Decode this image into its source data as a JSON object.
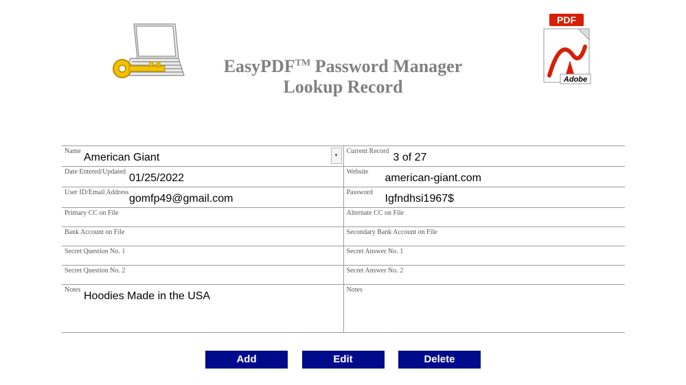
{
  "header": {
    "title_line1_pre": "EasyPDF",
    "title_line1_tm": "TM",
    "title_line1_post": " Password Manager",
    "title_line2": "Lookup Record",
    "pdf_badge": "PDF",
    "adobe_label": "Adobe"
  },
  "fields": {
    "name_label": "Name",
    "name_value": "American Giant",
    "current_record_label": "Current Record",
    "current_record_value": "3 of 27",
    "date_label": "Date Entered/Updated",
    "date_value": "01/25/2022",
    "website_label": "Website",
    "website_value": "american-giant.com",
    "userid_label": "User ID/Email Address",
    "userid_value": "gomfp49@gmail.com",
    "password_label": "Password",
    "password_value": "Igfndhsi1967$",
    "primary_cc_label": "Primary CC on File",
    "primary_cc_value": "",
    "alternate_cc_label": "Alternate CC on File",
    "alternate_cc_value": "",
    "bank_label": "Bank Account on File",
    "bank_value": "",
    "secondary_bank_label": "Secondary Bank Account on File",
    "secondary_bank_value": "",
    "secret_q1_label": "Secret Question No. 1",
    "secret_q1_value": "",
    "secret_a1_label": "Secret Answer No. 1",
    "secret_a1_value": "",
    "secret_q2_label": "Secret Question No. 2",
    "secret_q2_value": "",
    "secret_a2_label": "Secret Answer No. 2",
    "secret_a2_value": "",
    "notes_left_label": "Notes",
    "notes_left_value": "Hoodies Made in the USA",
    "notes_right_label": "Notes",
    "notes_right_value": ""
  },
  "buttons": {
    "add": "Add",
    "edit": "Edit",
    "delete": "Delete"
  }
}
